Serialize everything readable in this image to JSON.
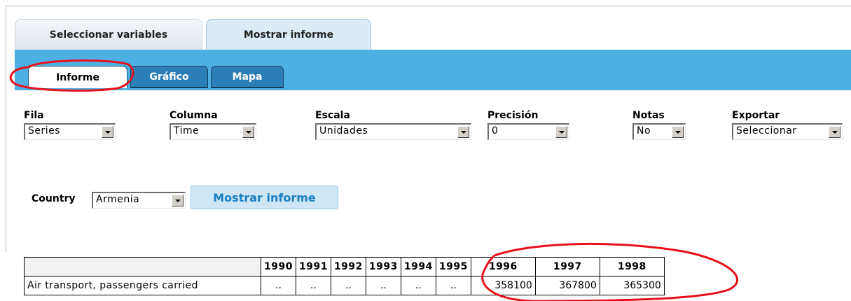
{
  "tabs": {
    "select_variables": "Seleccionar variables",
    "show_report": "Mostrar informe"
  },
  "subtabs": {
    "report": "Informe",
    "chart": "Gráfico",
    "map": "Mapa"
  },
  "controls": {
    "row": {
      "label": "Fila",
      "value": "Series"
    },
    "column": {
      "label": "Columna",
      "value": "Time"
    },
    "scale": {
      "label": "Escala",
      "value": "Unidades"
    },
    "precision": {
      "label": "Precisión",
      "value": "0"
    },
    "notes": {
      "label": "Notas",
      "value": "No"
    },
    "export": {
      "label": "Exportar",
      "value": "Seleccionar"
    }
  },
  "country": {
    "label": "Country",
    "value": "Armenia"
  },
  "show_button": "Mostrar informe",
  "table": {
    "years": [
      "1990",
      "1991",
      "1992",
      "1993",
      "1994",
      "1995",
      "1996",
      "1997",
      "1998"
    ],
    "rows": [
      {
        "label": "Air transport, passengers carried",
        "values": [
          "..",
          "..",
          "..",
          "..",
          "..",
          "..",
          "358100",
          "367800",
          "365300"
        ]
      }
    ]
  },
  "annotation_color": "#e8101a",
  "icons": [
    "chevron-down-icon"
  ]
}
